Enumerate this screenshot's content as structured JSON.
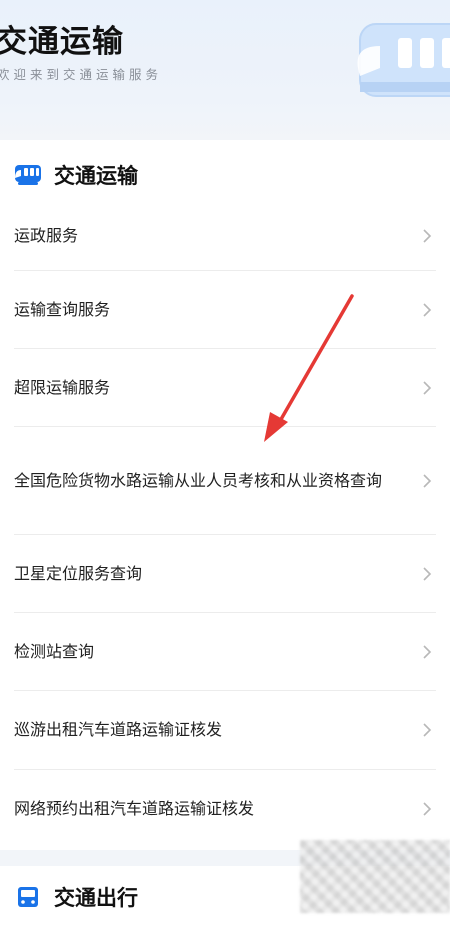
{
  "header": {
    "title": "交通运输",
    "subtitle": "欢迎来到交通运输服务"
  },
  "sections": [
    {
      "title": "交通运输",
      "icon": "bus-icon",
      "icon_color": "#1a73e8",
      "items": [
        {
          "label": "运政服务"
        },
        {
          "label": "运输查询服务"
        },
        {
          "label": "超限运输服务"
        },
        {
          "label": "全国危险货物水路运输从业人员考核和从业资格查询"
        },
        {
          "label": "卫星定位服务查询"
        },
        {
          "label": "检测站查询"
        },
        {
          "label": "巡游出租汽车道路运输证核发"
        },
        {
          "label": "网络预约出租汽车道路运输证核发"
        }
      ]
    },
    {
      "title": "交通出行",
      "icon": "bus-front-icon",
      "icon_color": "#1a73e8",
      "items": []
    }
  ],
  "colors": {
    "accent": "#1a73e8",
    "annotation_arrow": "#e53935",
    "chevron": "#b8b8b8"
  }
}
